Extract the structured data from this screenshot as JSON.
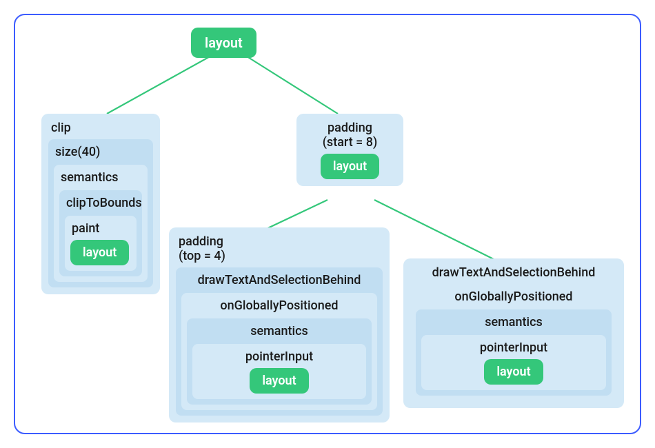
{
  "diagram": {
    "type": "tree",
    "root": {
      "label": "layout"
    },
    "nodes": {
      "left": {
        "title": "clip",
        "layers": [
          {
            "title": "size(40)",
            "layers": [
              {
                "title": "semantics",
                "layers": [
                  {
                    "title": "clipToBounds",
                    "layers": [
                      {
                        "title": "paint",
                        "terminal": "layout"
                      }
                    ]
                  }
                ]
              }
            ]
          }
        ]
      },
      "mid": {
        "title_line1": "padding",
        "title_line2": "(start = 8)",
        "terminal": "layout"
      },
      "bottom_left": {
        "title_line1": "padding",
        "title_line2": "(top = 4)",
        "layers": [
          {
            "title": "drawTextAndSelectionBehind",
            "layers": [
              {
                "title": "onGloballyPositioned",
                "layers": [
                  {
                    "title": "semantics",
                    "layers": [
                      {
                        "title": "pointerInput",
                        "terminal": "layout"
                      }
                    ]
                  }
                ]
              }
            ]
          }
        ]
      },
      "bottom_right": {
        "title": "drawTextAndSelectionBehind",
        "layers": [
          {
            "title": "onGloballyPositioned",
            "layers": [
              {
                "title": "semantics",
                "layers": [
                  {
                    "title": "pointerInput",
                    "terminal": "layout"
                  }
                ]
              }
            ]
          }
        ]
      }
    },
    "colors": {
      "accent_green": "#34c77a",
      "node_blue_light": "#d4e9f7",
      "node_blue_inner": "#c1def2",
      "frame_blue": "#3b5bff"
    }
  }
}
